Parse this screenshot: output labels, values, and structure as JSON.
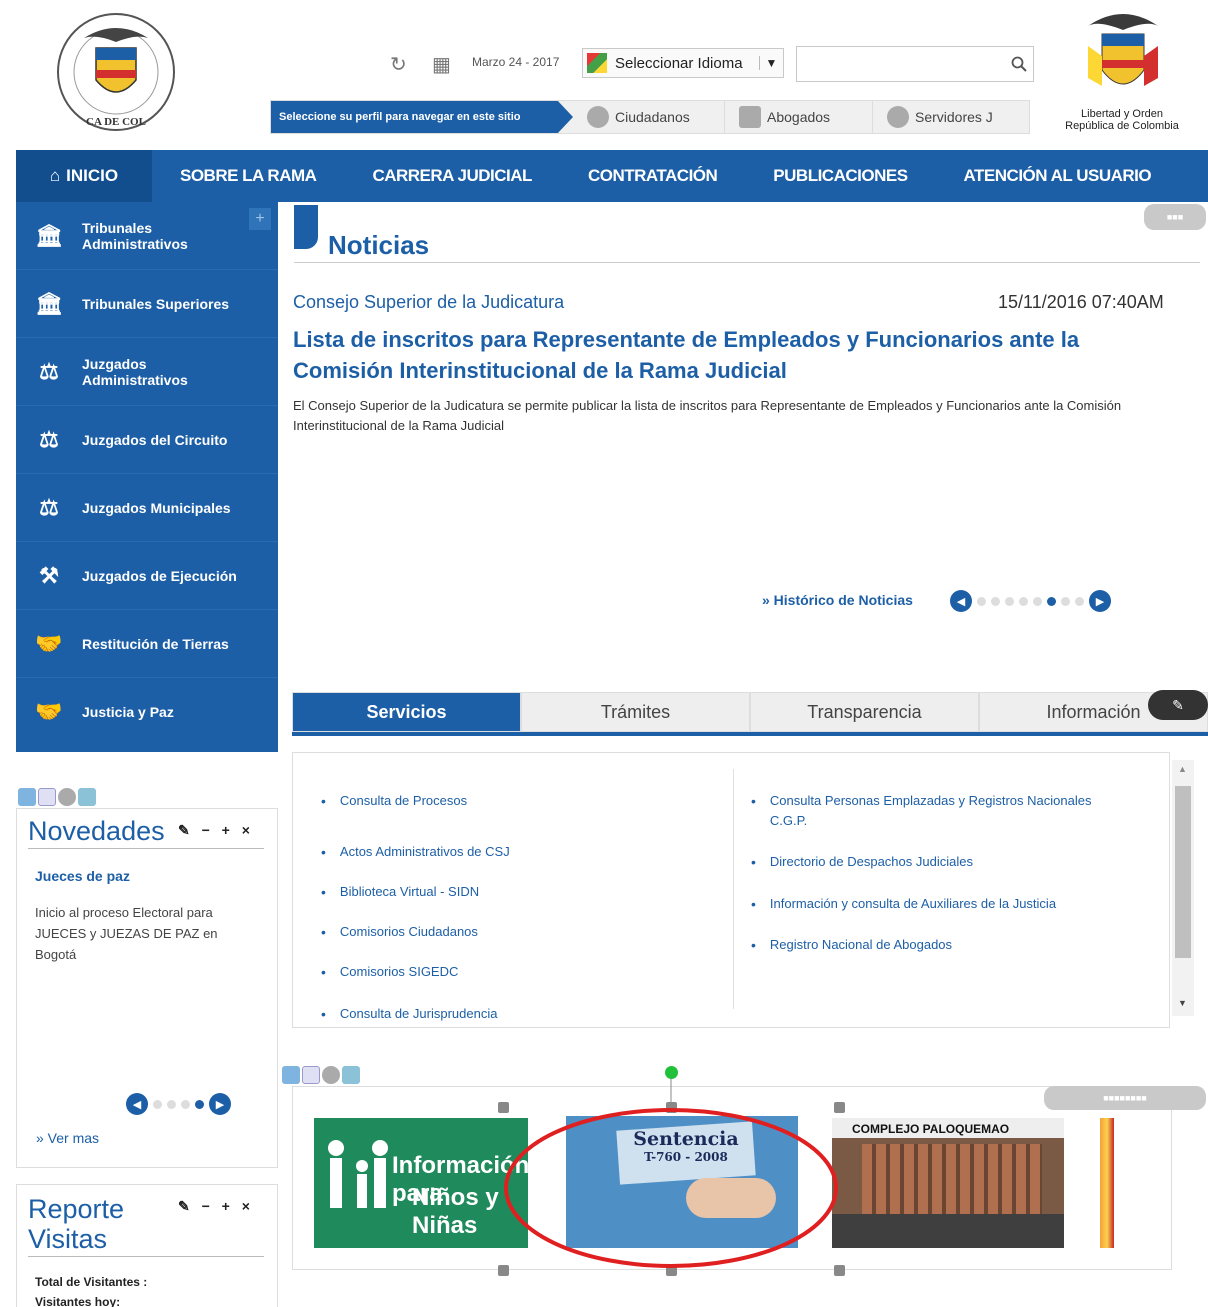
{
  "header": {
    "date": "Marzo 24 - 2017",
    "language_select": "Seleccionar Idioma",
    "search_value": "",
    "profile_prompt": "Seleccione su perfil para navegar en este sitio",
    "profiles": [
      "Ciudadanos",
      "Abogados",
      "Servidores J"
    ],
    "seal_caption_line1": "Libertad y Orden",
    "seal_caption_line2": "República de Colombia"
  },
  "nav": {
    "home": "INICIO",
    "items": [
      "SOBRE LA RAMA",
      "CARRERA JUDICIAL",
      "CONTRATACIÓN",
      "PUBLICACIONES",
      "ATENCIÓN AL USUARIO"
    ]
  },
  "sidebar": {
    "items": [
      {
        "label": "Tribunales Administrativos",
        "icon": "building-icon"
      },
      {
        "label": "Tribunales Superiores",
        "icon": "building-icon"
      },
      {
        "label": "Juzgados Administrativos",
        "icon": "scales-icon"
      },
      {
        "label": "Juzgados del Circuito",
        "icon": "scales-icon"
      },
      {
        "label": "Juzgados Municipales",
        "icon": "scales-icon"
      },
      {
        "label": "Juzgados de Ejecución",
        "icon": "gavel-icon"
      },
      {
        "label": "Restitución de Tierras",
        "icon": "handshake-icon"
      },
      {
        "label": "Justicia y Paz",
        "icon": "handshake-icon"
      }
    ]
  },
  "news": {
    "section_title": "Noticias",
    "source": "Consejo Superior de la Judicatura",
    "date": "15/11/2016 07:40AM",
    "headline": "Lista de inscritos para Representante de Empleados y Funcionarios ante la Comisión Interinstitucional de la Rama Judicial",
    "summary": "El Consejo Superior de la Judicatura se permite publicar la lista de inscritos para Representante de Empleados y Funcionarios ante la Comisión Interinstitucional de la Rama Judicial",
    "history_link": "» Histórico de Noticias",
    "page_count": 8,
    "current_page": 6
  },
  "tabs": {
    "items": [
      "Servicios",
      "Trámites",
      "Transparencia",
      "Información"
    ],
    "active": 0
  },
  "services": {
    "left": [
      "Consulta de Procesos",
      "Actos Administrativos de CSJ",
      "Biblioteca Virtual - SIDN",
      "Comisorios Ciudadanos",
      "Comisorios SIGEDC",
      "Consulta de Jurisprudencia"
    ],
    "right": [
      "Consulta Personas Emplazadas y Registros Nacionales C.G.P.",
      "Directorio de Despachos Judiciales",
      "Información y consulta de Auxiliares de la Justicia",
      "Registro Nacional de Abogados"
    ]
  },
  "novedades": {
    "title": "Novedades",
    "tools": "✎ − + ×",
    "heading": "Jueces de paz",
    "text": "Inicio al proceso Electoral para JUECES y JUEZAS DE PAZ en Bogotá",
    "more_link": "» Ver mas",
    "page_count": 4,
    "current_page": 4
  },
  "visits": {
    "title_line1": "Reporte",
    "title_line2": "Visitas",
    "tools": "✎ − + ×",
    "total_label": "Total de Visitantes :",
    "today_label": "Visitantes hoy:"
  },
  "banners": {
    "items": [
      {
        "name": "info-ninos",
        "line1": "Información para",
        "line2": "Niños y Niñas"
      },
      {
        "name": "sentencia",
        "line1": "Sentencia",
        "line2": "T-760 - 2008"
      },
      {
        "name": "paloquemao",
        "line1": "COMPLEJO PALOQUEMAO"
      }
    ]
  },
  "colors": {
    "brand_blue": "#1d5fa6",
    "annotation_red": "#e02020"
  }
}
